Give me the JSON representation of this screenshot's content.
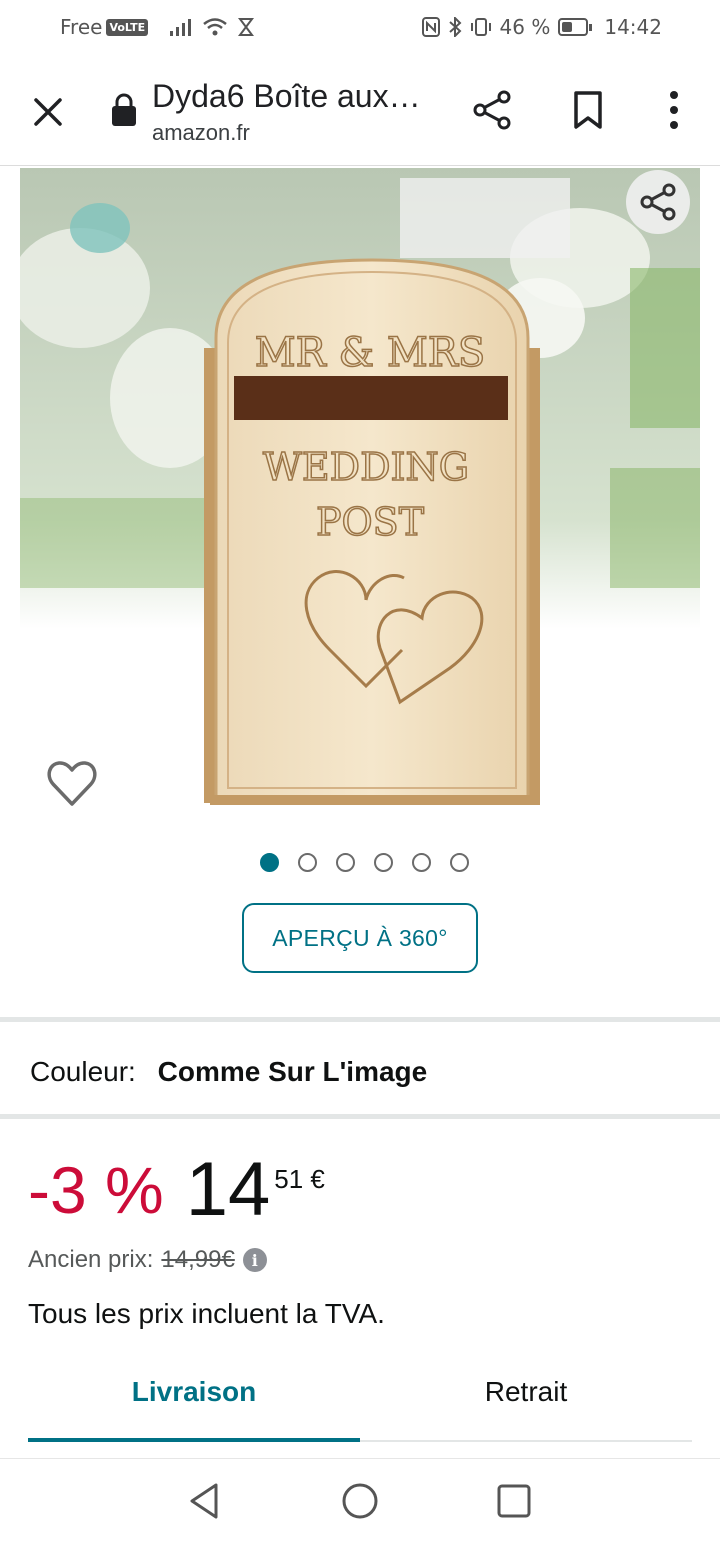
{
  "status_bar": {
    "carrier": "Free",
    "volte": "VoLTE",
    "battery_text": "46 %",
    "time": "14:42",
    "battery_level": 0.46
  },
  "browser": {
    "title": "Dyda6 Boîte aux…",
    "url": "amazon.fr"
  },
  "product_image": {
    "engraving_line1": "MR & MRS",
    "engraving_line2": "WEDDING",
    "engraving_line3": "POST"
  },
  "carousel": {
    "total": 6,
    "active_index": 0
  },
  "view360_label": "APERÇU À 360°",
  "color": {
    "label": "Couleur:",
    "value": "Comme Sur L'image"
  },
  "price": {
    "discount": "-3 %",
    "whole": "14",
    "fraction_currency": "51 €",
    "old_label": "Ancien prix:",
    "old_value": "14,99€",
    "tax_note": "Tous les prix incluent la TVA."
  },
  "tabs": [
    {
      "label": "Livraison",
      "active": true
    },
    {
      "label": "Retrait",
      "active": false
    }
  ],
  "colors": {
    "accent": "#007185",
    "discount": "#cc0c39"
  }
}
